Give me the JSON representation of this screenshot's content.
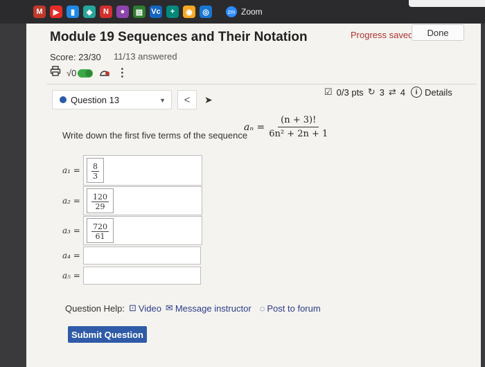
{
  "browser": {
    "bookmarks": [
      "M",
      "▶",
      "▮",
      "◆",
      "N",
      "●",
      "▤",
      "Vc",
      "+",
      "◉",
      "◎"
    ],
    "zoom_label": "Zoom"
  },
  "header": {
    "title": "Module 19 Sequences and Their Notation",
    "progress_saved": "Progress saved",
    "done_label": "Done",
    "score": "Score: 23/30",
    "answered": "11/13 answered",
    "sqrt_label": "√0",
    "more": "⋮"
  },
  "question_bar": {
    "selected_question": "Question 13",
    "prev": "<",
    "points": "0/3 pts",
    "retries": "3",
    "attempts": "4",
    "details": "Details"
  },
  "question": {
    "prompt": "Write down the first five terms of the sequence",
    "an": "aₙ =",
    "numerator": "(n + 3)!",
    "denominator": "6n² + 2n + 1",
    "terms": [
      {
        "label": "a₁ =",
        "num": "8",
        "den": "3"
      },
      {
        "label": "a₂ =",
        "num": "120",
        "den": "29"
      },
      {
        "label": "a₃ =",
        "num": "720",
        "den": "61"
      },
      {
        "label": "a₄ =",
        "num": "",
        "den": ""
      },
      {
        "label": "a₅ =",
        "num": "",
        "den": ""
      }
    ]
  },
  "help": {
    "label": "Question Help:",
    "video": "Video",
    "message": "Message instructor",
    "forum": "Post to forum"
  },
  "submit_label": "Submit Question",
  "colors": {
    "accent": "#2f5aa8",
    "progress": "#b03030",
    "toggle": "#3aa845"
  }
}
